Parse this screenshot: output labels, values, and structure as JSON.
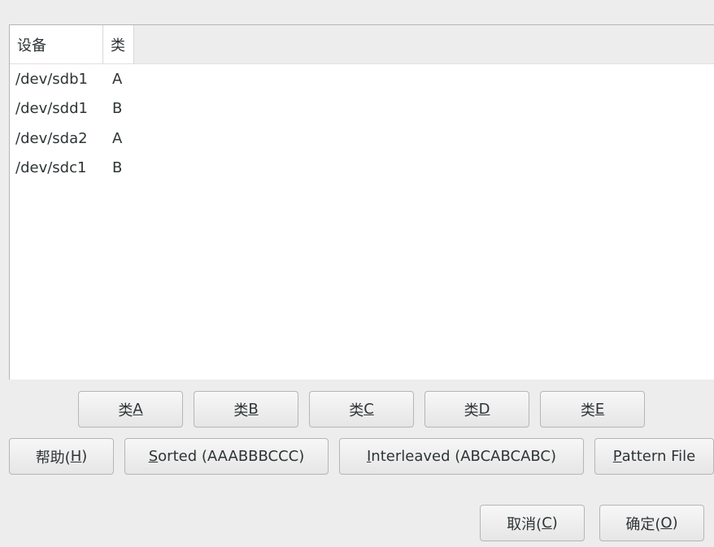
{
  "table": {
    "headers": {
      "device": "设备",
      "class": "类"
    },
    "rows": [
      {
        "device": "/dev/sdb1",
        "class": "A"
      },
      {
        "device": "/dev/sdd1",
        "class": "B"
      },
      {
        "device": "/dev/sda2",
        "class": "A"
      },
      {
        "device": "/dev/sdc1",
        "class": "B"
      }
    ]
  },
  "class_buttons": [
    {
      "prefix": "类 ",
      "key": "A"
    },
    {
      "prefix": "类 ",
      "key": "B"
    },
    {
      "prefix": "类 ",
      "key": "C"
    },
    {
      "prefix": "类 ",
      "key": "D"
    },
    {
      "prefix": "类 ",
      "key": "E"
    }
  ],
  "actions": {
    "help": {
      "pre": "帮助(",
      "key": "H",
      "post": ")"
    },
    "sorted": {
      "pre": "",
      "key": "S",
      "post": "orted (AAABBBCCC)"
    },
    "interleaved": {
      "pre": "",
      "key": "I",
      "post": "nterleaved (ABCABCABC)"
    },
    "pattern": {
      "pre": "",
      "key": "P",
      "post": "attern File"
    }
  },
  "dialog": {
    "cancel": {
      "pre": "取消(",
      "key": "C",
      "post": ")"
    },
    "ok": {
      "pre": "确定(",
      "key": "O",
      "post": ")"
    }
  }
}
